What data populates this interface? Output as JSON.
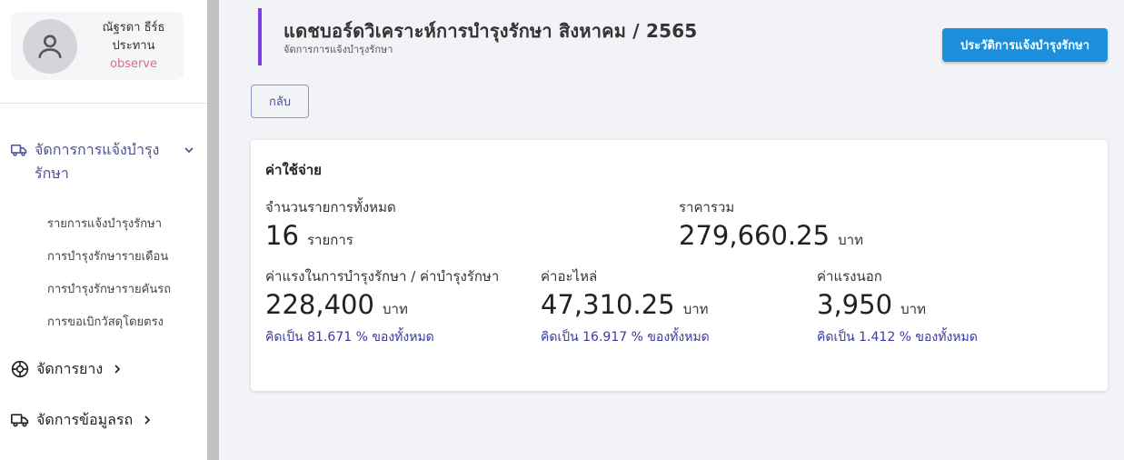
{
  "profile": {
    "name": "ณัฐรดา ธีร์ธ",
    "position": "ประทาน",
    "role_tag": "observe"
  },
  "sidebar": {
    "maintenance_menu": {
      "label": "จัดการการแจ้งบำรุงรักษา",
      "icon": "truck-icon",
      "items": [
        {
          "label": "รายการแจ้งบำรุงรักษา"
        },
        {
          "label": "การบำรุงรักษารายเดือน"
        },
        {
          "label": "การบำรุงรักษารายคันรถ"
        },
        {
          "label": "การขอเบิกวัสดุโดยตรง"
        }
      ]
    },
    "tire_menu": {
      "label": "จัดการยาง",
      "icon": "tire-icon"
    },
    "vehicle_menu": {
      "label": "จัดการข้อมูลรถ",
      "icon": "truck-icon"
    }
  },
  "header": {
    "title": "แดชบอร์ดวิเคราะห์การบำรุงรักษา สิงหาคม / 2565",
    "subtitle": "จัดการการแจ้งบำรุงรักษา",
    "history_button": "ประวัติการแจ้งบำรุงรักษา",
    "back_button": "กลับ"
  },
  "expense_card": {
    "title": "ค่าใช้จ่าย",
    "total_items": {
      "label": "จำนวนรายการทั้งหมด",
      "value": "16",
      "unit": "รายการ"
    },
    "total_price": {
      "label": "ราคารวม",
      "value": "279,660.25",
      "unit": "บาท"
    },
    "labor_cost": {
      "label": "ค่าแรงในการบำรุงรักษา / ค่าบำรุงรักษา",
      "value": "228,400",
      "unit": "บาท",
      "percent_text": "คิดเป็น 81.671 % ของทั้งหมด"
    },
    "parts_cost": {
      "label": "ค่าอะไหล่",
      "value": "47,310.25",
      "unit": "บาท",
      "percent_text": "คิดเป็น 16.917 % ของทั้งหมด"
    },
    "outside_labor": {
      "label": "ค่าแรงนอก",
      "value": "3,950",
      "unit": "บาท",
      "percent_text": "คิดเป็น 1.412 % ของทั้งหมด"
    }
  },
  "colors": {
    "accent_purple": "#7b3fe4",
    "primary_blue": "#1b8fdc",
    "nav_active": "#4a4f9b",
    "percent_text": "#3a3aa0",
    "role_tag": "#e06a86"
  }
}
